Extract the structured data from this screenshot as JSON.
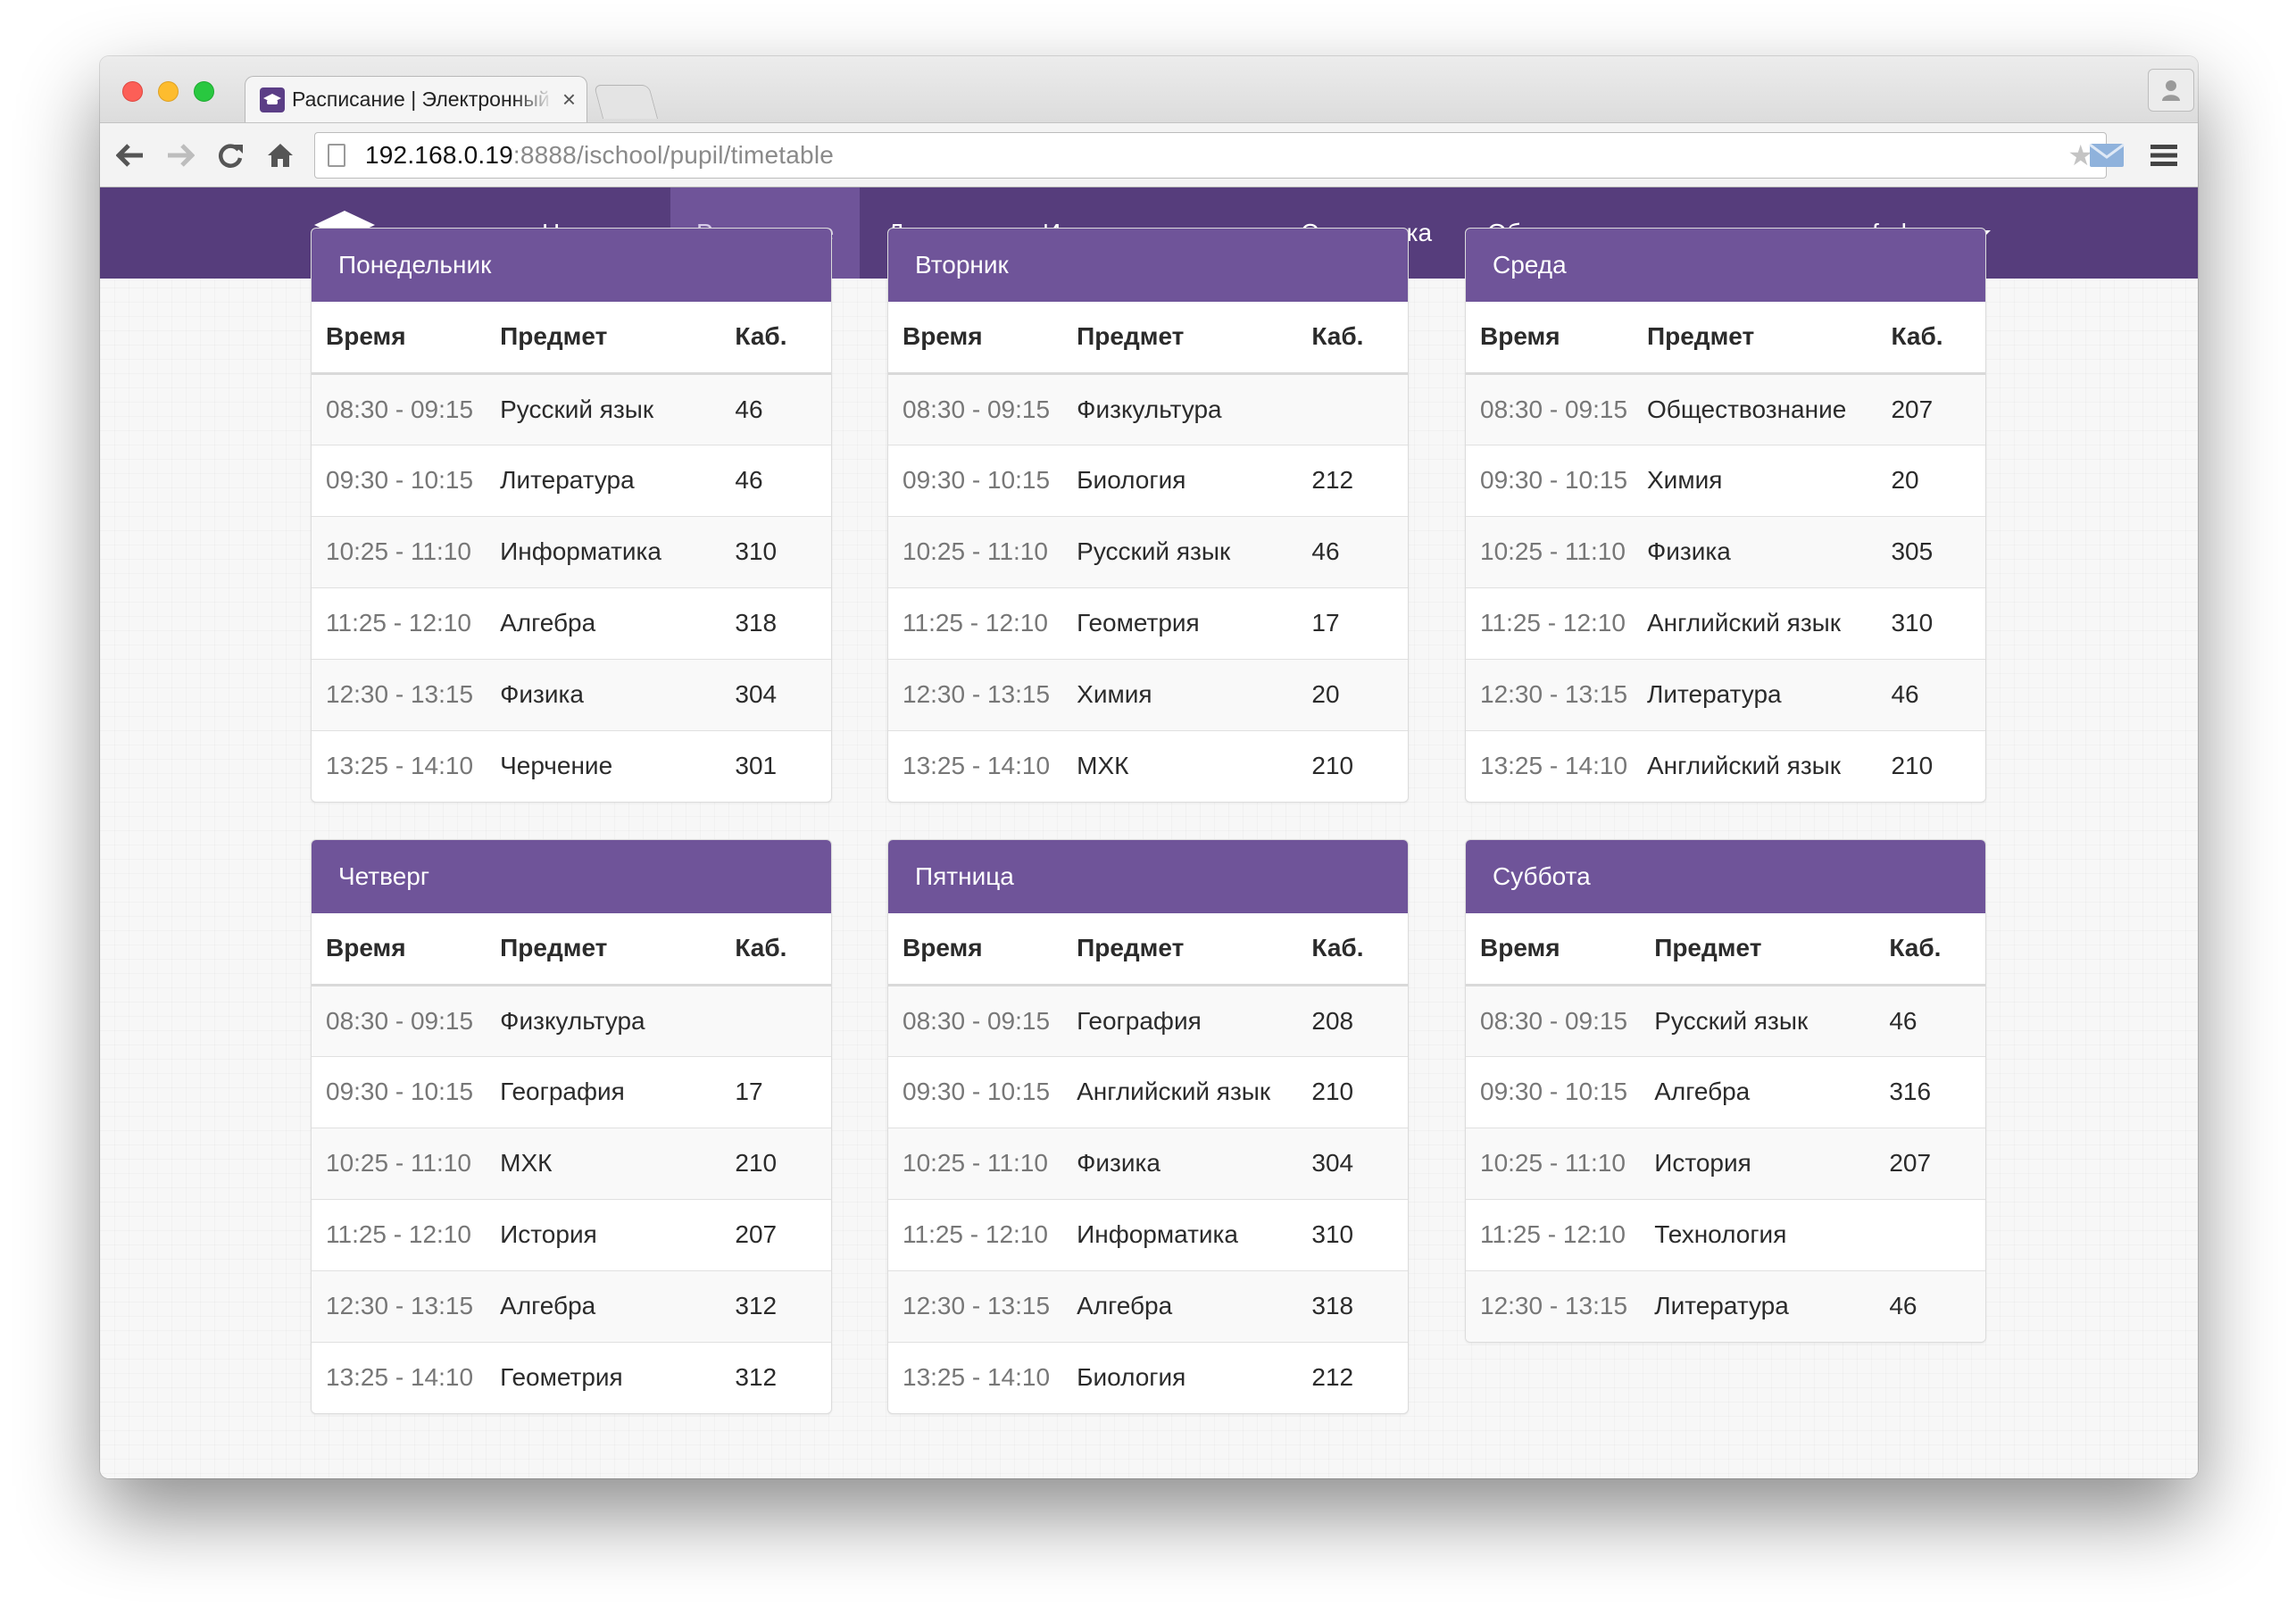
{
  "browser": {
    "tab_title": "Расписание | Электронный дневник",
    "url_host": "192.168.0.19",
    "url_rest": ":8888/ischool/pupil/timetable"
  },
  "icons": {
    "back": "arrow-left-icon",
    "forward": "arrow-right-icon",
    "reload": "reload-icon",
    "home": "home-icon",
    "bookmark": "star-icon",
    "mail": "mail-icon",
    "menu": "hamburger-icon",
    "brand": "graduation-cap-icon",
    "profile": "person-icon"
  },
  "colors": {
    "navbar": "#563d7c",
    "active_nav": "#6f5499",
    "panel_heading": "#6f5499"
  },
  "nav": {
    "items": [
      {
        "label": "Новости",
        "active": false
      },
      {
        "label": "Расписание",
        "active": true
      },
      {
        "label": "Дневник",
        "active": false
      },
      {
        "label": "Итоговые оценки",
        "active": false
      },
      {
        "label": "Статистика",
        "active": false
      },
      {
        "label": "Общение",
        "active": false
      }
    ],
    "user": "fedorova"
  },
  "table_headers": {
    "time": "Время",
    "subject": "Предмет",
    "room": "Каб."
  },
  "days": [
    {
      "name": "Понедельник",
      "lessons": [
        {
          "time": "08:30 - 09:15",
          "subject": "Русский язык",
          "room": "46"
        },
        {
          "time": "09:30 - 10:15",
          "subject": "Литература",
          "room": "46"
        },
        {
          "time": "10:25 - 11:10",
          "subject": "Информатика",
          "room": "310"
        },
        {
          "time": "11:25 - 12:10",
          "subject": "Алгебра",
          "room": "318"
        },
        {
          "time": "12:30 - 13:15",
          "subject": "Физика",
          "room": "304"
        },
        {
          "time": "13:25 - 14:10",
          "subject": "Черчение",
          "room": "301"
        }
      ]
    },
    {
      "name": "Вторник",
      "lessons": [
        {
          "time": "08:30 - 09:15",
          "subject": "Физкультура",
          "room": ""
        },
        {
          "time": "09:30 - 10:15",
          "subject": "Биология",
          "room": "212"
        },
        {
          "time": "10:25 - 11:10",
          "subject": "Русский язык",
          "room": "46"
        },
        {
          "time": "11:25 - 12:10",
          "subject": "Геометрия",
          "room": "17"
        },
        {
          "time": "12:30 - 13:15",
          "subject": "Химия",
          "room": "20"
        },
        {
          "time": "13:25 - 14:10",
          "subject": "МХК",
          "room": "210"
        }
      ]
    },
    {
      "name": "Среда",
      "lessons": [
        {
          "time": "08:30 - 09:15",
          "subject": "Обществознание",
          "room": "207"
        },
        {
          "time": "09:30 - 10:15",
          "subject": "Химия",
          "room": "20"
        },
        {
          "time": "10:25 - 11:10",
          "subject": "Физика",
          "room": "305"
        },
        {
          "time": "11:25 - 12:10",
          "subject": "Английский язык",
          "room": "310"
        },
        {
          "time": "12:30 - 13:15",
          "subject": "Литература",
          "room": "46"
        },
        {
          "time": "13:25 - 14:10",
          "subject": "Английский язык",
          "room": "210"
        }
      ]
    },
    {
      "name": "Четверг",
      "lessons": [
        {
          "time": "08:30 - 09:15",
          "subject": "Физкультура",
          "room": ""
        },
        {
          "time": "09:30 - 10:15",
          "subject": "География",
          "room": "17"
        },
        {
          "time": "10:25 - 11:10",
          "subject": "МХК",
          "room": "210"
        },
        {
          "time": "11:25 - 12:10",
          "subject": "История",
          "room": "207"
        },
        {
          "time": "12:30 - 13:15",
          "subject": "Алгебра",
          "room": "312"
        },
        {
          "time": "13:25 - 14:10",
          "subject": "Геометрия",
          "room": "312"
        }
      ]
    },
    {
      "name": "Пятница",
      "lessons": [
        {
          "time": "08:30 - 09:15",
          "subject": "География",
          "room": "208"
        },
        {
          "time": "09:30 - 10:15",
          "subject": "Английский язык",
          "room": "210"
        },
        {
          "time": "10:25 - 11:10",
          "subject": "Физика",
          "room": "304"
        },
        {
          "time": "11:25 - 12:10",
          "subject": "Информатика",
          "room": "310"
        },
        {
          "time": "12:30 - 13:15",
          "subject": "Алгебра",
          "room": "318"
        },
        {
          "time": "13:25 - 14:10",
          "subject": "Биология",
          "room": "212"
        }
      ]
    },
    {
      "name": "Суббота",
      "lessons": [
        {
          "time": "08:30 - 09:15",
          "subject": "Русский язык",
          "room": "46"
        },
        {
          "time": "09:30 - 10:15",
          "subject": "Алгебра",
          "room": "316"
        },
        {
          "time": "10:25 - 11:10",
          "subject": "История",
          "room": "207"
        },
        {
          "time": "11:25 - 12:10",
          "subject": "Технология",
          "room": ""
        },
        {
          "time": "12:30 - 13:15",
          "subject": "Литература",
          "room": "46"
        }
      ]
    }
  ]
}
